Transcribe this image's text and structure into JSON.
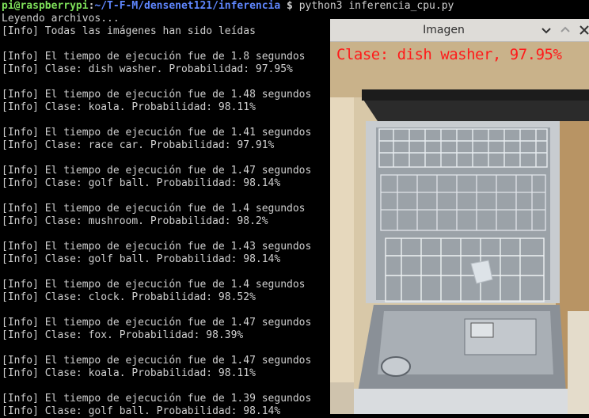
{
  "terminal": {
    "prompt_user": "pi@raspberrypi",
    "prompt_sep": ":",
    "prompt_path": "~/T-F-M/densenet121/inferencia",
    "prompt_dollar": " $",
    "command": " python3 inferencia_cpu.py",
    "lines": [
      "Leyendo archivos...",
      "[Info] Todas las imágenes han sido leídas",
      "",
      "[Info] El tiempo de ejecución fue de 1.8 segundos",
      "[Info] Clase: dish washer. Probabilidad: 97.95%",
      "",
      "[Info] El tiempo de ejecución fue de 1.48 segundos",
      "[Info] Clase: koala. Probabilidad: 98.11%",
      "",
      "[Info] El tiempo de ejecución fue de 1.41 segundos",
      "[Info] Clase: race car. Probabilidad: 97.91%",
      "",
      "[Info] El tiempo de ejecución fue de 1.47 segundos",
      "[Info] Clase: golf ball. Probabilidad: 98.14%",
      "",
      "[Info] El tiempo de ejecución fue de 1.4 segundos",
      "[Info] Clase: mushroom. Probabilidad: 98.2%",
      "",
      "[Info] El tiempo de ejecución fue de 1.43 segundos",
      "[Info] Clase: golf ball. Probabilidad: 98.14%",
      "",
      "[Info] El tiempo de ejecución fue de 1.4 segundos",
      "[Info] Clase: clock. Probabilidad: 98.52%",
      "",
      "[Info] El tiempo de ejecución fue de 1.47 segundos",
      "[Info] Clase: fox. Probabilidad: 98.39%",
      "",
      "[Info] El tiempo de ejecución fue de 1.47 segundos",
      "[Info] Clase: koala. Probabilidad: 98.11%",
      "",
      "[Info] El tiempo de ejecución fue de 1.39 segundos",
      "[Info] Clase: golf ball. Probabilidad: 98.14%"
    ]
  },
  "image_window": {
    "title": "Imagen",
    "overlay_label": "Clase: dish washer, 97.95%",
    "overlay_color": "#ff1a1a",
    "buttons": [
      "chevron-down-icon",
      "chevron-up-icon",
      "close-icon"
    ]
  },
  "colors": {
    "terminal_bg": "#000000",
    "terminal_text": "#cfcfcf",
    "prompt_user": "#7ee05a",
    "prompt_path": "#5f87ff",
    "titlebar_bg": "#dedcd8"
  }
}
